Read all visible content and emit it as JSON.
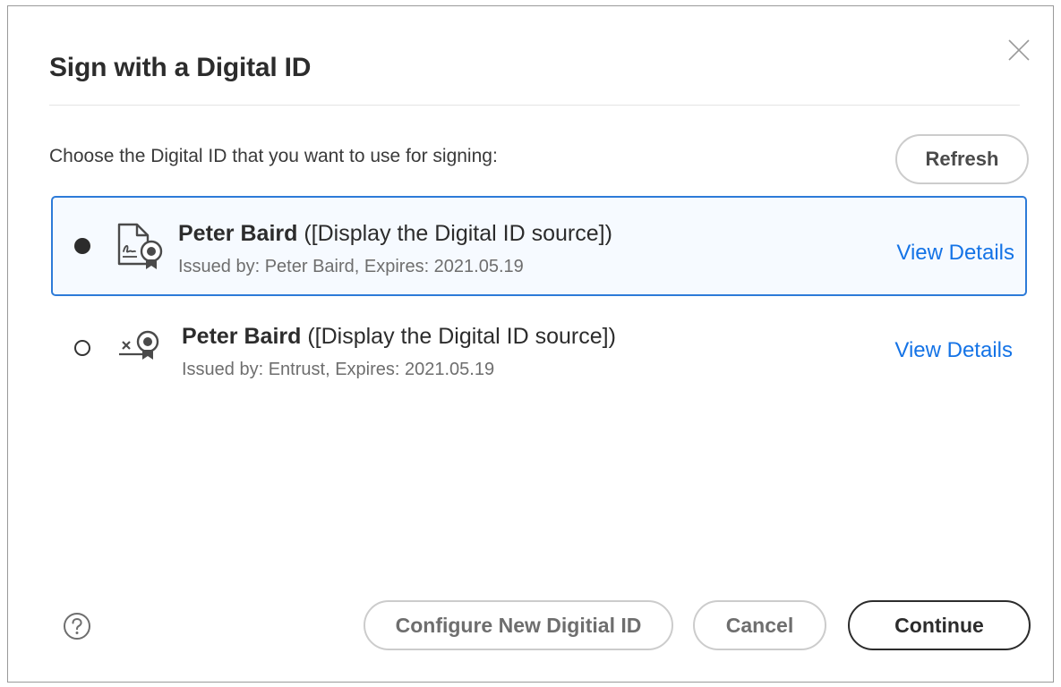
{
  "dialog": {
    "title": "Sign with a Digital ID",
    "close_icon": "close-icon",
    "instructions": "Choose the Digital ID that you want to use for signing:",
    "refresh_label": "Refresh"
  },
  "digital_ids": [
    {
      "selected": true,
      "name": "Peter Baird",
      "source": " ([Display the Digital ID source])",
      "issued": "Issued by: Peter Baird, Expires: 2021.05.19",
      "view_details": "View Details",
      "icon": "signature-certificate-icon"
    },
    {
      "selected": false,
      "name": "Peter Baird",
      "source": " ([Display the Digital ID source])",
      "issued": "Issued by: Entrust, Expires: 2021.05.19",
      "view_details": "View Details",
      "icon": "signature-line-certificate-icon"
    }
  ],
  "footer": {
    "help_icon": "help-icon",
    "configure_label": "Configure New Digitial ID",
    "cancel_label": "Cancel",
    "continue_label": "Continue"
  },
  "colors": {
    "accent": "#2d7bd8",
    "link": "#1473e6",
    "selected_background": "#f6faff"
  }
}
